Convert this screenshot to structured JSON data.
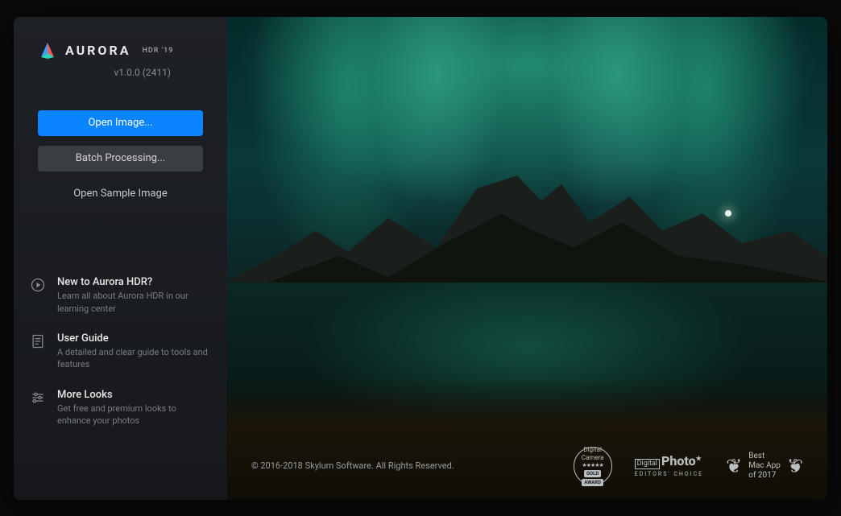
{
  "app": {
    "name": "AURORA",
    "suffix": "HDR '19",
    "version": "v1.0.0 (2411)"
  },
  "buttons": {
    "open_image": "Open Image...",
    "batch_processing": "Batch Processing...",
    "open_sample": "Open Sample Image"
  },
  "resources": [
    {
      "title": "New to Aurora HDR?",
      "desc": "Learn all about Aurora HDR in our learning center",
      "icon": "play-circle-icon"
    },
    {
      "title": "User Guide",
      "desc": "A detailed and clear guide to tools and features",
      "icon": "document-icon"
    },
    {
      "title": "More Looks",
      "desc": "Get free and premium looks to enhance your photos",
      "icon": "sliders-icon"
    }
  ],
  "footer": {
    "copyright": "© 2016-2018 Skylum Software. All Rights Reserved."
  },
  "awards": {
    "camera": {
      "line1": "Digital",
      "line2": "Camera",
      "stars": "★★★★★",
      "badge1": "GOLD",
      "badge2": "AWARD"
    },
    "photo": {
      "prefix": "Digital",
      "brand": "Photo",
      "subtitle": "EDITORS' CHOICE"
    },
    "mac": {
      "line1": "Best",
      "line2": "Mac App",
      "line3": "of 2017"
    }
  }
}
